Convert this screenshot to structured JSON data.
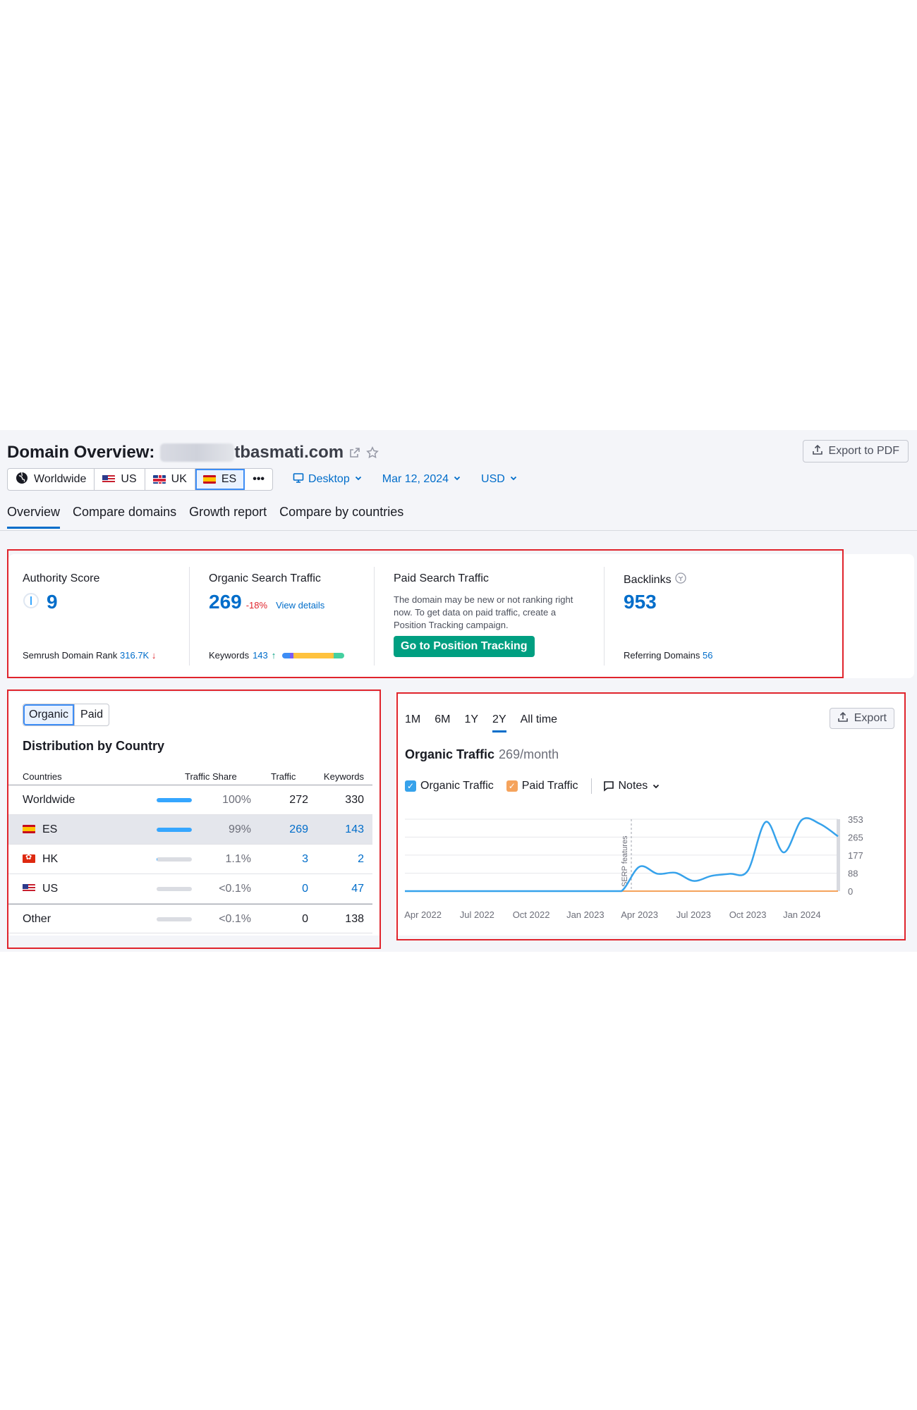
{
  "header": {
    "title": "Domain Overview:",
    "domain": "tbasmati.com",
    "export_pdf_label": "Export to PDF"
  },
  "filters": {
    "databases": [
      {
        "label": "Worldwide",
        "flag": "globe-icon"
      },
      {
        "label": "US",
        "flag": "us-flag"
      },
      {
        "label": "UK",
        "flag": "uk-flag"
      },
      {
        "label": "ES",
        "flag": "es-flag",
        "selected": true
      }
    ],
    "more_label": "•••",
    "device": "Desktop",
    "date": "Mar 12, 2024",
    "currency": "USD"
  },
  "tabs": [
    "Overview",
    "Compare domains",
    "Growth report",
    "Compare by countries"
  ],
  "metrics": {
    "authority": {
      "label": "Authority Score",
      "value": "9",
      "rank_label": "Semrush Domain Rank",
      "rank_value": "316.7K"
    },
    "organic": {
      "label": "Organic Search Traffic",
      "value": "269",
      "change": "-18%",
      "details_link": "View details",
      "keywords_label": "Keywords",
      "keywords_value": "143"
    },
    "paid": {
      "label": "Paid Search Traffic",
      "description": "The domain may be new or not ranking right now. To get data on paid traffic, create a Position Tracking campaign.",
      "button": "Go to Position Tracking"
    },
    "backlinks": {
      "label": "Backlinks",
      "value": "953",
      "ref_label": "Referring Domains",
      "ref_value": "56"
    }
  },
  "distribution": {
    "toggle": [
      "Organic",
      "Paid"
    ],
    "title": "Distribution by Country",
    "columns": [
      "Countries",
      "Traffic Share",
      "Traffic",
      "Keywords"
    ],
    "rows": [
      {
        "country": "Worldwide",
        "flag": "",
        "share": "100%",
        "share_frac": 1.0,
        "traffic": "272",
        "keywords": "330",
        "link": false,
        "highlight": false
      },
      {
        "country": "ES",
        "flag": "es-flag",
        "share": "99%",
        "share_frac": 0.99,
        "traffic": "269",
        "keywords": "143",
        "link": true,
        "highlight": true
      },
      {
        "country": "HK",
        "flag": "hk-flag",
        "share": "1.1%",
        "share_frac": 0.011,
        "traffic": "3",
        "keywords": "2",
        "link": true,
        "highlight": false
      },
      {
        "country": "US",
        "flag": "us-flag",
        "share": "<0.1%",
        "share_frac": 0.001,
        "traffic": "0",
        "keywords": "47",
        "link": true,
        "highlight": false
      },
      {
        "country": "Other",
        "flag": "",
        "share": "<0.1%",
        "share_frac": 0.001,
        "traffic": "0",
        "keywords": "138",
        "link": false,
        "highlight": false
      }
    ]
  },
  "chart_panel": {
    "ranges": [
      "1M",
      "6M",
      "1Y",
      "2Y",
      "All time"
    ],
    "selected_range": "2Y",
    "export_label": "Export",
    "title": "Organic Traffic",
    "subtitle": "269/month",
    "legend": {
      "organic": "Organic Traffic",
      "paid": "Paid Traffic",
      "notes": "Notes"
    },
    "annotation": "SERP features"
  },
  "colors": {
    "organic": "#36a2eb",
    "paid": "#f5a35c",
    "accent": "#006dca",
    "button_green": "#009f81",
    "highlight_red": "#e0242c"
  },
  "chart_data": {
    "type": "line",
    "x": [
      "2022-03",
      "2022-04",
      "2022-05",
      "2022-06",
      "2022-07",
      "2022-08",
      "2022-09",
      "2022-10",
      "2022-11",
      "2022-12",
      "2023-01",
      "2023-02",
      "2023-03",
      "2023-04",
      "2023-05",
      "2023-06",
      "2023-07",
      "2023-08",
      "2023-09",
      "2023-10",
      "2023-11",
      "2023-12",
      "2024-01",
      "2024-02",
      "2024-03"
    ],
    "x_tick_labels": [
      "Apr 2022",
      "Jul 2022",
      "Oct 2022",
      "Jan 2023",
      "Apr 2023",
      "Jul 2023",
      "Oct 2023",
      "Jan 2024"
    ],
    "series": [
      {
        "name": "Organic Traffic",
        "values": [
          0,
          0,
          0,
          0,
          0,
          0,
          0,
          0,
          0,
          0,
          0,
          0,
          0,
          120,
          85,
          90,
          50,
          75,
          85,
          100,
          340,
          190,
          350,
          330,
          269
        ]
      },
      {
        "name": "Paid Traffic",
        "values": [
          0,
          0,
          0,
          0,
          0,
          0,
          0,
          0,
          0,
          0,
          0,
          0,
          0,
          0,
          0,
          0,
          0,
          0,
          0,
          0,
          0,
          0,
          0,
          0,
          0
        ]
      }
    ],
    "y_ticks": [
      0,
      88,
      177,
      265,
      353
    ],
    "ylim": [
      0,
      353
    ],
    "grid": true,
    "annotations": [
      {
        "x": "2023-03",
        "label": "SERP features"
      }
    ]
  }
}
